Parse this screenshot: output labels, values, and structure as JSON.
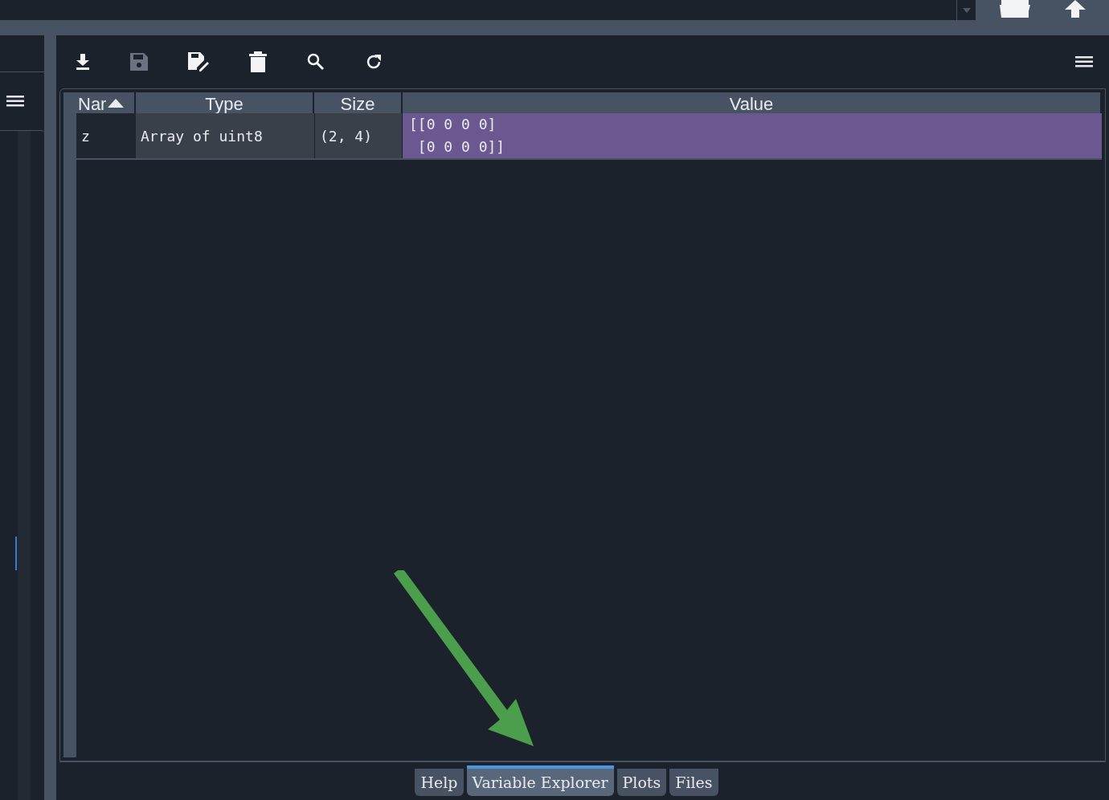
{
  "table": {
    "columns": [
      {
        "label": "Nar",
        "sorted": true
      },
      {
        "label": "Type",
        "sorted": false
      },
      {
        "label": "Size",
        "sorted": false
      },
      {
        "label": "Value",
        "sorted": false
      }
    ],
    "rows": [
      {
        "name": "z",
        "type": "Array of uint8",
        "size": "(2, 4)",
        "value": "[[0 0 0 0]\n [0 0 0 0]]",
        "color": "#6c5891"
      }
    ]
  },
  "tabs": [
    {
      "label": "Help",
      "selected": false
    },
    {
      "label": "Variable Explorer",
      "selected": true
    },
    {
      "label": "Plots",
      "selected": false
    },
    {
      "label": "Files",
      "selected": false
    }
  ]
}
